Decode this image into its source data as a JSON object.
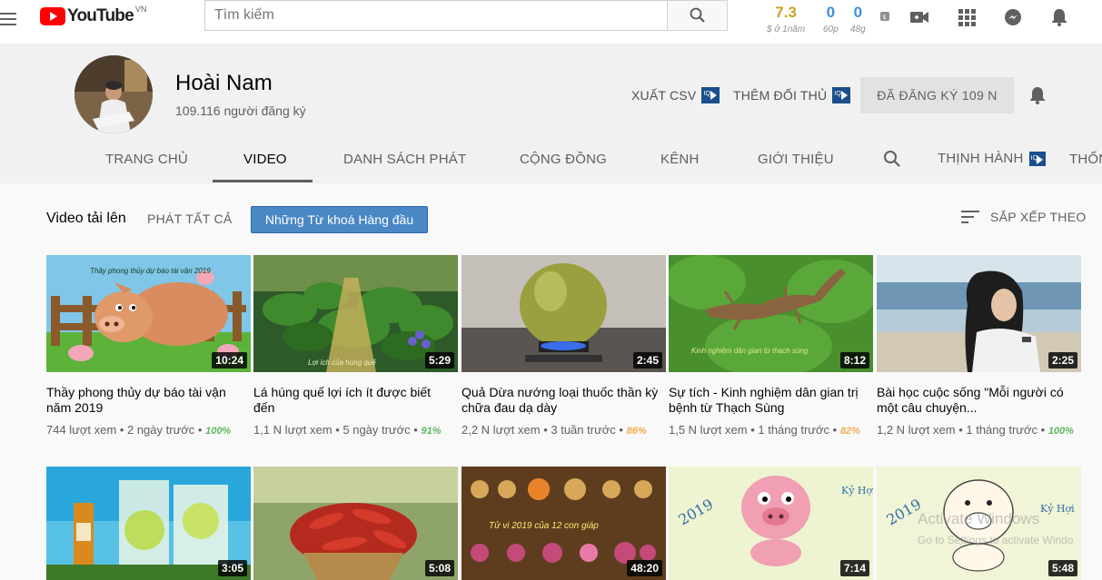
{
  "masthead": {
    "logo_text": "YouTube",
    "country": "VN",
    "search_placeholder": "Tìm kiếm",
    "stats": [
      {
        "value": "7.3",
        "sub": "$ ở 1năm",
        "color": "#c9a227"
      },
      {
        "value": "0",
        "sub": "60p",
        "color": "#3d8ee0"
      },
      {
        "value": "0",
        "sub": "48g",
        "color": "#3d8ee0"
      }
    ]
  },
  "channel": {
    "name": "Hoài Nam",
    "subscribers": "109.116 người đăng ký",
    "export_csv": "XUẤT CSV",
    "add_competitor": "THÊM ĐỐI THỦ",
    "subscribed": "ĐÃ ĐĂNG KÝ  109 N"
  },
  "tabs": {
    "home": "TRANG CHỦ",
    "videos": "VIDEO",
    "playlists": "DANH SÁCH PHÁT",
    "community": "CỘNG ĐỒNG",
    "channels": "KÊNH",
    "about": "GIỚI THIỆU",
    "trending": "THỊNH HÀNH",
    "stats": "THỐN"
  },
  "section": {
    "title": "Video tải lên",
    "play_all": "PHÁT TẤT CẢ",
    "keywords_button": "Những Từ khoá Hàng đầu",
    "sort_by": "SẮP XẾP THEO"
  },
  "videos_row1": [
    {
      "title": "Thầy phong thủy dự báo tài vận năm 2019",
      "duration": "10:24",
      "views": "744 lượt xem",
      "age": "2 ngày trước",
      "pct": "100%",
      "pct_color": "#5cb85c",
      "caption": "Thầy phong thủy dự báo tài vận 2019"
    },
    {
      "title": "Lá húng quế lợi ích ít được biết đến",
      "duration": "5:29",
      "views": "1,1 N lượt xem",
      "age": "5 ngày trước",
      "pct": "91%",
      "pct_color": "#5cb85c",
      "caption": "Lợi ích của húng quế"
    },
    {
      "title": "Quả Dừa nướng loại thuốc thần kỳ chữa đau dạ dày",
      "duration": "2:45",
      "views": "2,2 N lượt xem",
      "age": "3 tuần trước",
      "pct": "86%",
      "pct_color": "#f0ad4e",
      "caption": ""
    },
    {
      "title": "Sự tích - Kinh nghiệm dân gian trị bệnh từ Thạch Sùng",
      "duration": "8:12",
      "views": "1,5 N lượt xem",
      "age": "1 tháng trước",
      "pct": "82%",
      "pct_color": "#f0ad4e",
      "caption": "Kinh nghiệm dân gian từ thạch sùng"
    },
    {
      "title": "Bài học cuộc sống \"Mỗi người có một câu chuyện...",
      "duration": "2:25",
      "views": "1,2 N lượt xem",
      "age": "1 tháng trước",
      "pct": "100%",
      "pct_color": "#5cb85c",
      "caption": ""
    }
  ],
  "videos_row2": [
    {
      "duration": "3:05"
    },
    {
      "duration": "5:08"
    },
    {
      "duration": "48:20",
      "caption": "Tử vi 2019 của 12 con giáp"
    },
    {
      "duration": "7:14"
    },
    {
      "duration": "5:48"
    }
  ],
  "watermark": {
    "line1": "Activate Windows",
    "line2": "Go to Settings to activate Windo"
  }
}
